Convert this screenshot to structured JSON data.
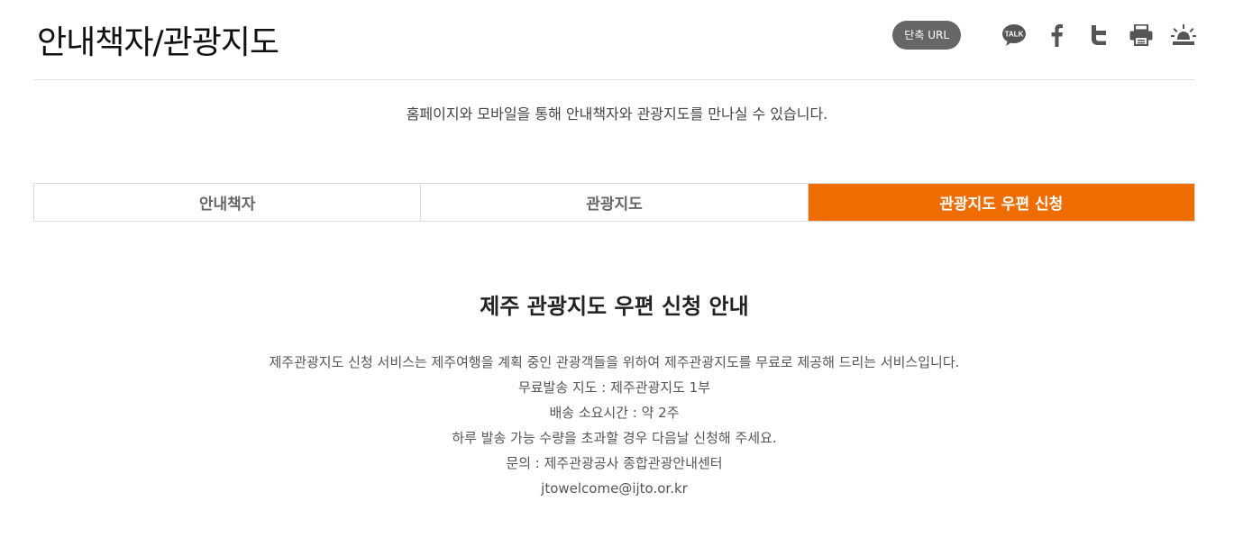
{
  "header": {
    "title": "안내책자/관광지도",
    "short_url_label": "단축 URL",
    "share_icons": [
      "kakaotalk-icon",
      "facebook-icon",
      "twitter-icon",
      "print-icon",
      "alert-icon"
    ],
    "kakao_label": "TALK"
  },
  "intro": "홈페이지와 모바일을 통해 안내책자와 관광지도를 만나실 수 있습니다.",
  "tabs": [
    {
      "label": "안내책자",
      "active": false
    },
    {
      "label": "관광지도",
      "active": false
    },
    {
      "label": "관광지도 우편 신청",
      "active": true
    }
  ],
  "colors": {
    "accent": "#ef6c00",
    "icon": "#555555"
  },
  "content": {
    "title": "제주 관광지도 우편 신청 안내",
    "lines": [
      "제주관광지도 신청 서비스는 제주여행을 계획 중인 관광객들을 위하여 제주관광지도를 무료로 제공해 드리는 서비스입니다.",
      "무료발송 지도 : 제주관광지도 1부",
      "배송 소요시간 : 약 2주",
      "하루 발송 가능 수량을 초과할 경우 다음날 신청해 주세요.",
      "문의 : 제주관광공사 종합관광안내센터",
      "jtowelcome@ijto.or.kr"
    ]
  }
}
